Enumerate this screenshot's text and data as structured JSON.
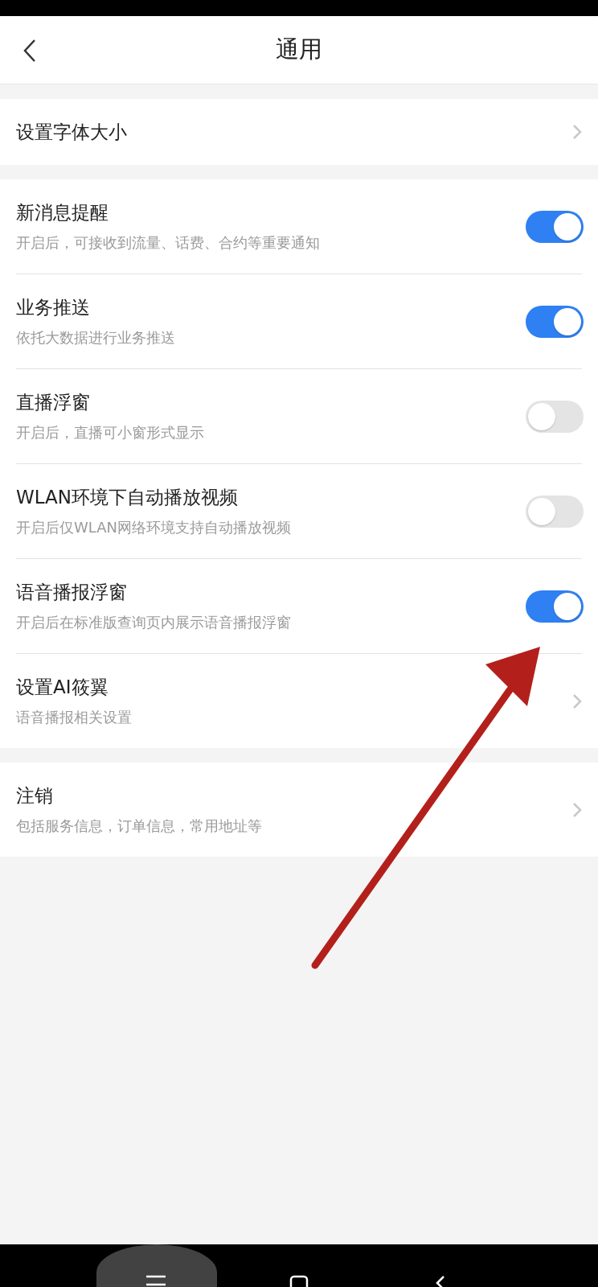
{
  "header": {
    "title": "通用"
  },
  "sections": [
    {
      "items": [
        {
          "kind": "link",
          "title": "设置字体大小"
        }
      ]
    },
    {
      "items": [
        {
          "kind": "toggle",
          "title": "新消息提醒",
          "subtitle": "开启后，可接收到流量、话费、合约等重要通知",
          "on": true
        },
        {
          "kind": "toggle",
          "title": "业务推送",
          "subtitle": "依托大数据进行业务推送",
          "on": true
        },
        {
          "kind": "toggle",
          "title": "直播浮窗",
          "subtitle": "开启后，直播可小窗形式显示",
          "on": false
        },
        {
          "kind": "toggle",
          "title": "WLAN环境下自动播放视频",
          "subtitle": "开启后仅WLAN网络环境支持自动播放视频",
          "on": false
        },
        {
          "kind": "toggle",
          "title": "语音播报浮窗",
          "subtitle": "开启后在标准版查询页内展示语音播报浮窗",
          "on": true
        },
        {
          "kind": "link",
          "title": "设置AI筱翼",
          "subtitle": "语音播报相关设置"
        }
      ]
    },
    {
      "items": [
        {
          "kind": "link",
          "title": "注销",
          "subtitle": "包括服务信息，订单信息，常用地址等"
        }
      ]
    }
  ]
}
